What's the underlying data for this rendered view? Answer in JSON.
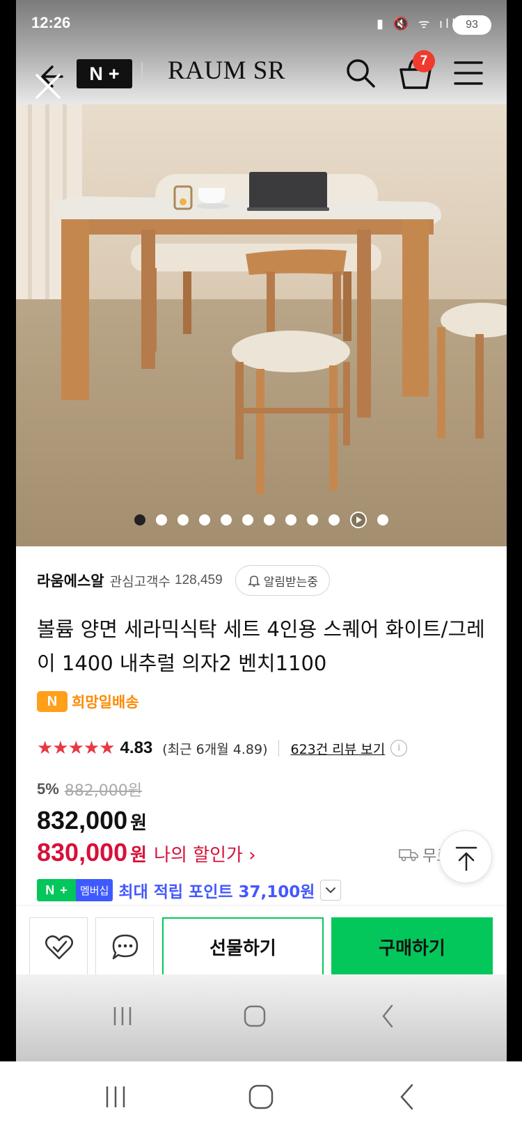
{
  "status_bar": {
    "time": "12:26",
    "icons_text": "▮ 🔇 ᯤ ıll",
    "battery": "93"
  },
  "header": {
    "brand": "RAUM SR",
    "np_symbol_n": "N",
    "np_symbol_plus": "+",
    "cart_count": "7"
  },
  "gallery": {
    "total_images": 12,
    "current_index": 0,
    "video_index": 10
  },
  "store": {
    "name": "라움에스알",
    "interest_label": "관심고객수",
    "interest_count": "128,459",
    "alert_label": "알림받는중"
  },
  "product": {
    "title": "볼륨 양면 세라믹식탁 세트 4인용 스퀘어 화이트/그레이 1400 내추럴 의자2 벤치1100",
    "delivery_badge": "N",
    "delivery_label": "희망일배송",
    "stars": "★★★★★",
    "rating": "4.83",
    "recent_rating": "(최근 6개월 4.89)",
    "review_link": "623건 리뷰 보기",
    "discount_rate": "5%",
    "original_price": "882,000원",
    "price": "832,000",
    "price_unit": "원",
    "my_price": "830,000",
    "my_price_unit": "원",
    "my_price_label": "나의 할인가 ›",
    "shipping_label": "무료",
    "points_badge_n": "N",
    "points_badge_plus": "+",
    "points_badge_membership": "멤버십",
    "points_text": "최대 적립 포인트 37,100원"
  },
  "actions": {
    "gift_label": "선물하기",
    "buy_label": "구매하기"
  },
  "colors": {
    "accent_green": "#03c75a",
    "price_red": "#d6113a",
    "star_red": "#e63946",
    "delivery_orange": "#ff8a00",
    "points_blue": "#4458ff"
  }
}
